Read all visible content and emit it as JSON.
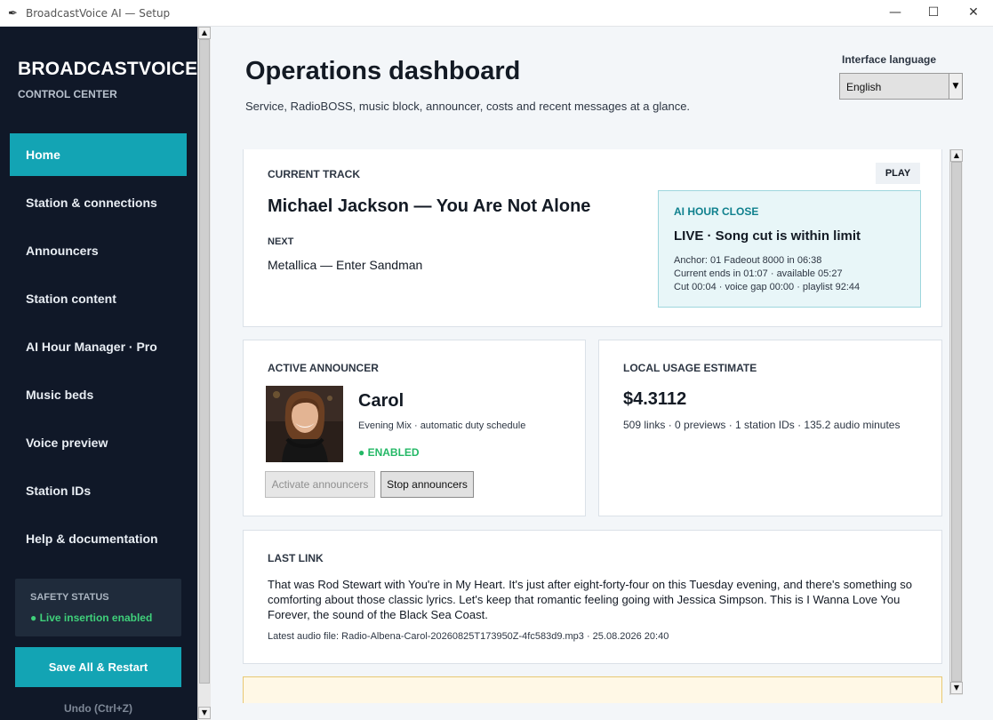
{
  "window": {
    "title": "BroadcastVoice AI — Setup",
    "minimize": "—",
    "maximize": "☐",
    "close": "✕"
  },
  "sidebar": {
    "brand": "BROADCASTVOICE",
    "brand_sub": "CONTROL CENTER",
    "items": [
      {
        "label": "Home",
        "active": true
      },
      {
        "label": "Station & connections"
      },
      {
        "label": "Announcers"
      },
      {
        "label": "Station content"
      },
      {
        "label": "AI Hour Manager · Pro"
      },
      {
        "label": "Music beds"
      },
      {
        "label": "Voice preview"
      },
      {
        "label": "Station IDs"
      },
      {
        "label": "Help & documentation"
      }
    ],
    "safety_label": "SAFETY STATUS",
    "safety_value": "● Live insertion enabled",
    "save_label": "Save All & Restart",
    "undo_label": "Undo  (Ctrl+Z)"
  },
  "header": {
    "title": "Operations dashboard",
    "subtitle": "Service, RadioBOSS, music block, announcer, costs and recent messages at a glance.",
    "language_label": "Interface language",
    "language_value": "English"
  },
  "current_track": {
    "label": "CURRENT TRACK",
    "title": "Michael Jackson — You Are Not Alone",
    "next_label": "NEXT",
    "next": "Metallica — Enter Sandman",
    "play_label": "PLAY",
    "ai_label": "AI HOUR CLOSE",
    "ai_status": "LIVE · Song cut is within limit",
    "ai_lines": [
      "Anchor: 01 Fadeout 8000 in 06:38",
      "Current ends in 01:07 · available 05:27",
      "Cut 00:04 · voice gap 00:00 · playlist 92:44"
    ]
  },
  "announcer": {
    "label": "ACTIVE ANNOUNCER",
    "name": "Carol",
    "subtitle": "Evening Mix · automatic duty schedule",
    "status": "● ENABLED",
    "activate_label": "Activate announcers",
    "stop_label": "Stop announcers"
  },
  "usage": {
    "label": "LOCAL USAGE ESTIMATE",
    "cost": "$4.3112",
    "details": "509 links · 0 previews · 1 station IDs · 135.2 audio minutes"
  },
  "last_link": {
    "label": "LAST LINK",
    "text": "That was Rod Stewart with You're in My Heart. It's just after eight-forty-four on this Tuesday evening, and there's something so comforting about those classic lyrics. Let's keep that romantic feeling going with Jessica Simpson. This is I Wanna Love You Forever, the sound of the Black Sea Coast.",
    "file": "Latest audio file: Radio-Albena-Carol-20260825T173950Z-4fc583d9.mp3 · 25.08.2026 20:40"
  },
  "colors": {
    "sidebar_bg": "#101828",
    "accent": "#13a4b4",
    "success": "#24b866",
    "ai_box_bg": "#e8f6f8"
  }
}
